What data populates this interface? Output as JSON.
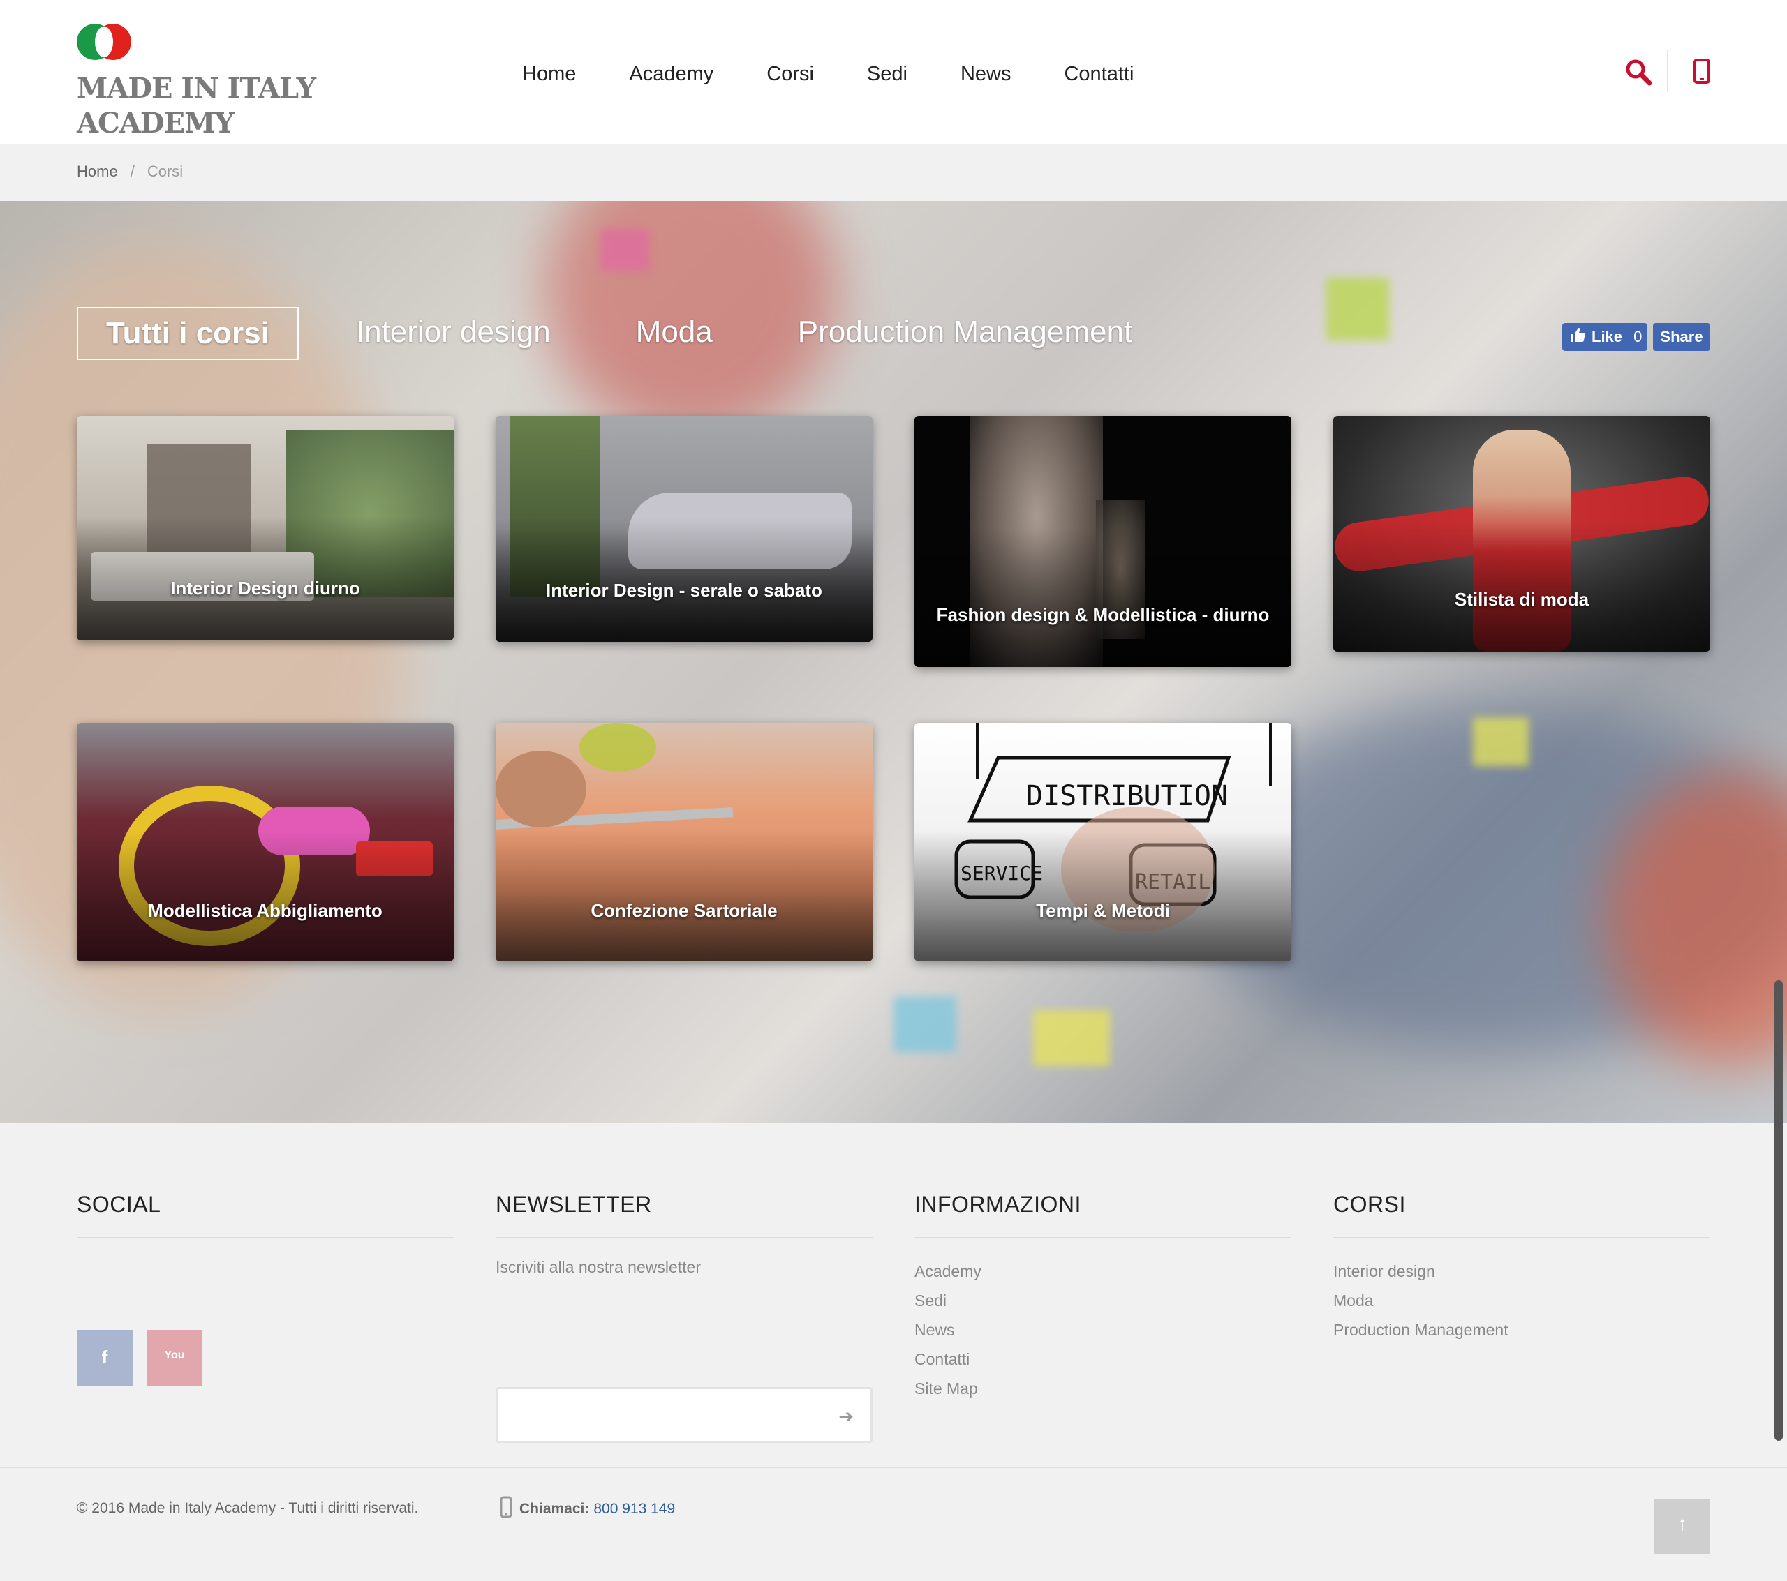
{
  "brand": {
    "logo_line1": "MADE IN ITALY",
    "logo_line2": "ACADEMY",
    "accent_color": "#c8102e"
  },
  "nav": {
    "items": [
      {
        "label": "Home"
      },
      {
        "label": "Academy"
      },
      {
        "label": "Corsi"
      },
      {
        "label": "Sedi"
      },
      {
        "label": "News"
      },
      {
        "label": "Contatti"
      }
    ],
    "search_icon": "search-icon",
    "phone_icon": "phone-icon"
  },
  "breadcrumb": {
    "home": "Home",
    "separator": "/",
    "current": "Corsi"
  },
  "filters": {
    "tabs": [
      {
        "label": "Tutti i corsi",
        "active": true
      },
      {
        "label": "Interior design",
        "active": false
      },
      {
        "label": "Moda",
        "active": false
      },
      {
        "label": "Production Management",
        "active": false
      }
    ]
  },
  "facebook": {
    "like_label": "Like",
    "like_count": "0",
    "share_label": "Share"
  },
  "courses": [
    {
      "title": "Interior Design diurno"
    },
    {
      "title": "Interior Design - serale o sabato"
    },
    {
      "title": "Fashion design & Modellistica - diurno"
    },
    {
      "title": "Stilista di moda"
    },
    {
      "title": "Modellistica Abbigliamento"
    },
    {
      "title": "Confezione Sartoriale"
    },
    {
      "title": "Tempi & Metodi"
    }
  ],
  "footer": {
    "social": {
      "heading": "SOCIAL",
      "facebook_icon": "facebook-icon",
      "youtube_icon": "youtube-icon",
      "youtube_text": "You"
    },
    "newsletter": {
      "heading": "NEWSLETTER",
      "text": "Iscriviti alla nostra newsletter",
      "input_value": "",
      "submit_icon": "arrow-right-icon"
    },
    "info": {
      "heading": "INFORMAZIONI",
      "links": [
        "Academy",
        "Sedi",
        "News",
        "Contatti",
        "Site Map"
      ]
    },
    "corsi": {
      "heading": "CORSI",
      "links": [
        "Interior design",
        "Moda",
        "Production Management"
      ]
    },
    "copyright": "© 2016 Made in Italy Academy - Tutti i diritti riservati.",
    "call_label": "Chiamaci:",
    "call_number": "800 913 149",
    "to_top_icon": "arrow-up-icon"
  }
}
